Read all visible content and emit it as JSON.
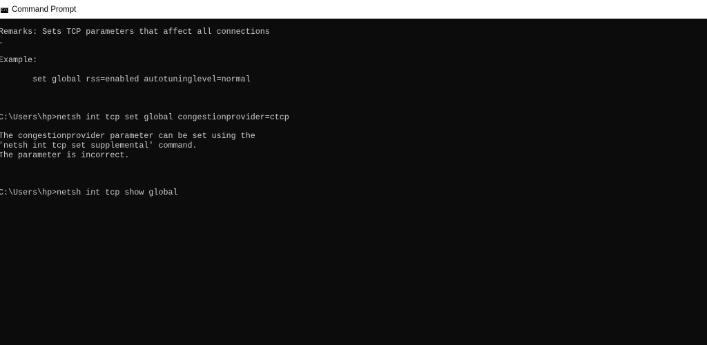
{
  "window": {
    "title": "Command Prompt"
  },
  "console": {
    "lines": [
      "Remarks: Sets TCP parameters that affect all connections",
      ".",
      "Example:",
      "       set global rss=enabled autotuninglevel=normal",
      "C:\\Users\\hp>netsh int tcp set global congestionprovider=ctcp",
      "The congestionprovider parameter can be set using the",
      "'netsh int tcp set supplemental' command.",
      "The parameter is incorrect.",
      "C:\\Users\\hp>netsh int tcp show global"
    ]
  }
}
